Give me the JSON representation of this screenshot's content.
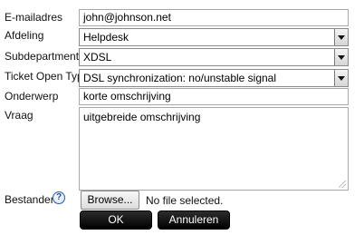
{
  "form": {
    "email": {
      "label": "E-mailadres",
      "value": "john@johnson.net"
    },
    "department": {
      "label": "Afdeling",
      "value": "Helpdesk"
    },
    "subdepartment": {
      "label": "Subdepartment",
      "value": "XDSL"
    },
    "ticket_type": {
      "label": "Ticket Open Type",
      "value": "DSL synchronization: no/unstable signal"
    },
    "subject": {
      "label": "Onderwerp",
      "value": "korte omschrijving"
    },
    "question": {
      "label": "Vraag",
      "value": "uitgebreide omschrijving"
    },
    "files": {
      "label": "Bestanden",
      "help_icon": "question-circle-icon",
      "browse_label": "Browse...",
      "status": "No file selected."
    }
  },
  "actions": {
    "ok_label": "OK",
    "cancel_label": "Annuleren"
  },
  "colors": {
    "help_icon": "#2a5caa",
    "button_bg": "#000000",
    "field_border": "#a8a8a8"
  }
}
